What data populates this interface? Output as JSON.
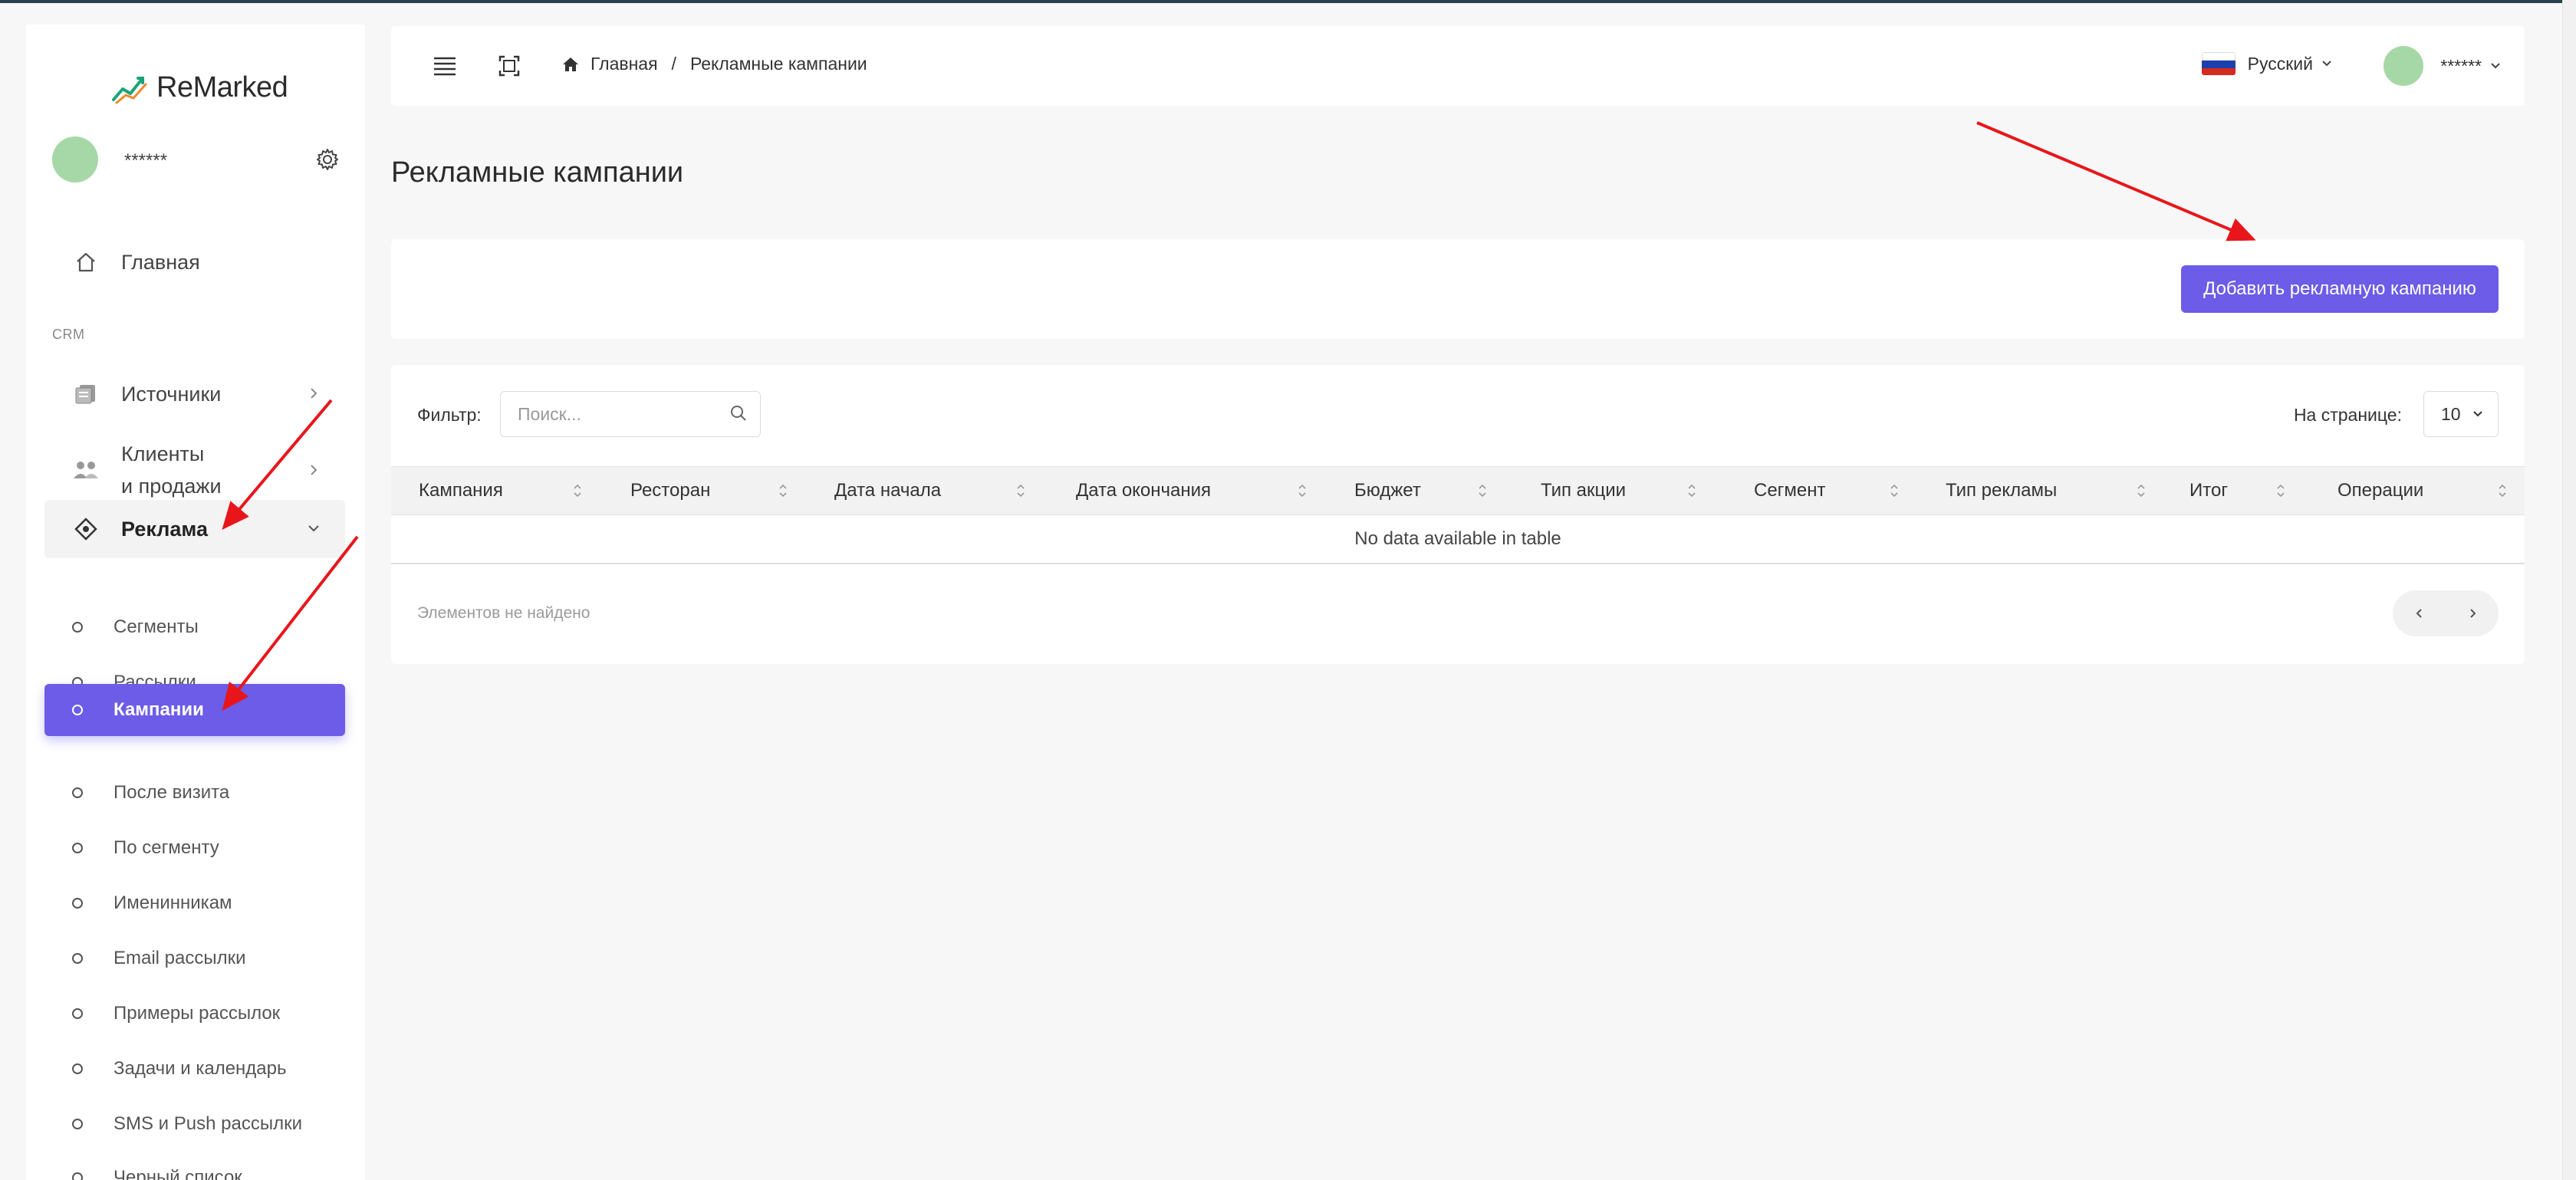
{
  "app": {
    "brand": "ReMarked",
    "user": "******"
  },
  "sidebar": {
    "home": "Главная",
    "section_crm": "CRM",
    "sources": "Источники",
    "clients_line1": "Клиенты",
    "clients_line2": "и продажи",
    "ads": "Реклама",
    "sub_items": [
      "Сегменты",
      "Рассылки",
      "Кампании",
      "После визита",
      "По сегменту",
      "Именинникам",
      "Email рассылки",
      "Примеры рассылок",
      "Задачи и календарь",
      "SMS и Push рассылки",
      "Черный список"
    ]
  },
  "header": {
    "breadcrumb_home": "Главная",
    "breadcrumb_sep": "/",
    "breadcrumb_current": "Рекламные кампании",
    "language": "Русский",
    "user": "******"
  },
  "page": {
    "title": "Рекламные кампании",
    "add_button": "Добавить рекламную кампанию"
  },
  "table": {
    "filter_label": "Фильтр:",
    "search_placeholder": "Поиск...",
    "per_page_label": "На странице:",
    "per_page_value": "10",
    "columns": [
      "Кампания",
      "Ресторан",
      "Дата начала",
      "Дата окончания",
      "Бюджет",
      "Тип акции",
      "Сегмент",
      "Тип рекламы",
      "Итог",
      "Операции"
    ],
    "empty": "No data available in table",
    "info": "Элементов не найдено"
  },
  "colors": {
    "accent": "#6c5ce7",
    "arrow": "#e8161b",
    "avatar": "#a5d8a6"
  }
}
